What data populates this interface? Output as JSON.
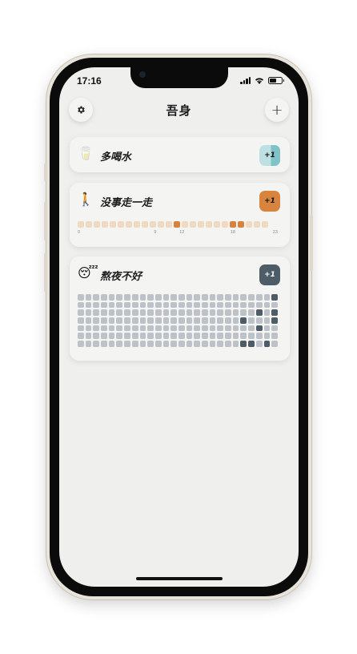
{
  "status_bar": {
    "time": "17:16"
  },
  "header": {
    "title": "吾身",
    "settings_icon": "gear-icon",
    "add_label": "+"
  },
  "habits": [
    {
      "emoji": "🥛",
      "title": "多喝水",
      "plus_label": "+1",
      "color": "#7fc2c8"
    },
    {
      "emoji": "🚶",
      "title": "没事走一走",
      "plus_label": "+1",
      "color": "#d9843e",
      "hour_active": [
        12,
        19,
        20
      ],
      "hour_ticks": [
        "0",
        "9",
        "12",
        "18",
        "23"
      ]
    },
    {
      "emoji": "😴",
      "title": "熬夜不好",
      "plus_label": "+1",
      "color": "#4e5c68",
      "grid_rows": 7,
      "grid_cols": 26,
      "active_cells": [
        [
          0,
          25
        ],
        [
          2,
          23
        ],
        [
          2,
          25
        ],
        [
          3,
          21
        ],
        [
          3,
          25
        ],
        [
          4,
          23
        ],
        [
          6,
          21
        ],
        [
          6,
          22
        ],
        [
          6,
          24
        ]
      ]
    }
  ],
  "colors": {
    "accent_walk": "#d9843e",
    "accent_night": "#4e5c68",
    "accent_water": "#7fc2c8"
  }
}
